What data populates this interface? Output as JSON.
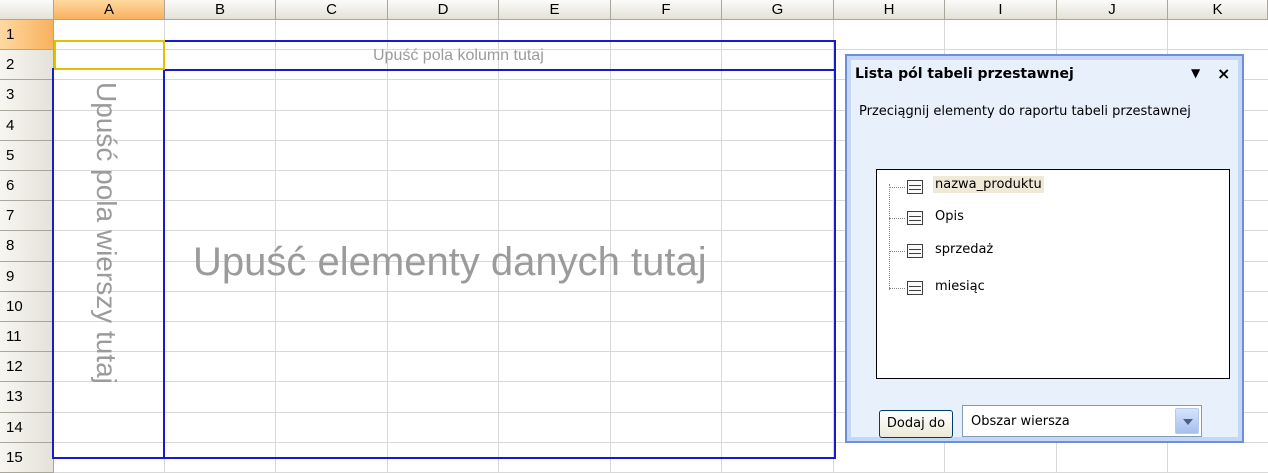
{
  "sheet": {
    "columns": [
      "A",
      "B",
      "C",
      "D",
      "E",
      "F",
      "G",
      "H",
      "I",
      "J",
      "K"
    ],
    "rows": [
      "1",
      "2",
      "3",
      "4",
      "5",
      "6",
      "7",
      "8",
      "9",
      "10",
      "11",
      "12",
      "13",
      "14",
      "15"
    ],
    "active_column": "A",
    "active_row": "1"
  },
  "pivot": {
    "column_drop_hint": "Upuść pola kolumn tutaj",
    "row_drop_hint": "Upuść pola wierszy tutaj",
    "data_drop_hint": "Upuść elementy danych tutaj"
  },
  "field_list": {
    "title": "Lista pól tabeli przestawnej",
    "menu_icon": "dropdown-arrow",
    "close_icon": "close",
    "instruction": "Przeciągnij elementy do raportu tabeli przestawnej",
    "fields": [
      "nazwa_produktu",
      "Opis",
      "sprzedaż",
      "miesiąc"
    ],
    "highlighted_field": "nazwa_produktu",
    "add_button_label": "Dodaj do",
    "area_select_value": "Obszar wiersza"
  },
  "colors": {
    "pivot_outline": "#1a1acc",
    "header_selected": "#f8b15e",
    "panel_border": "#6d8fd9"
  }
}
